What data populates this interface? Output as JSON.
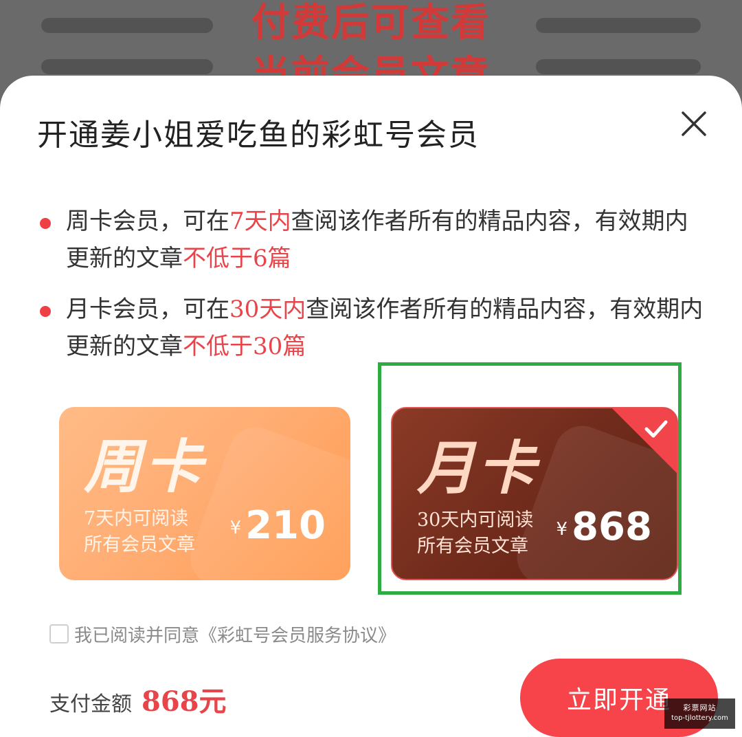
{
  "background": {
    "line1": "付费后可查看",
    "line2": "当前会员文章"
  },
  "sheet": {
    "title": "开通姜小姐爱吃鱼的彩虹号会员"
  },
  "benefits": [
    {
      "p1": "周卡会员，可在",
      "hl1": "7天内",
      "p2": "查阅该作者所有的精品内容，有效期内更新的文章",
      "hl2": "不低于6篇"
    },
    {
      "p1": "月卡会员，可在",
      "hl1": "30天内",
      "p2": "查阅该作者所有的精品内容，有效期内更新的文章",
      "hl2": "不低于30篇"
    }
  ],
  "plans": [
    {
      "name": "周卡",
      "desc1": "7天内可阅读",
      "desc2": "所有会员文章",
      "currency": "¥",
      "price": "210",
      "selected": false
    },
    {
      "name": "月卡",
      "desc1": "30天内可阅读",
      "desc2": "所有会员文章",
      "currency": "¥",
      "price": "868",
      "selected": true
    }
  ],
  "agreement": {
    "text": "我已阅读并同意《彩虹号会员服务协议》",
    "checked": false
  },
  "payment": {
    "label": "支付金额",
    "amount": "868元"
  },
  "actions": {
    "open_label": "立即开通"
  },
  "watermark": {
    "title": "彩票网站",
    "url": "top-tjlottery.com"
  },
  "colors": {
    "accent": "#f7444a",
    "highlight_text": "#e8454a",
    "selection_box": "#2fab44",
    "week_card": "#ffac72",
    "month_card": "#6e2a1b"
  }
}
